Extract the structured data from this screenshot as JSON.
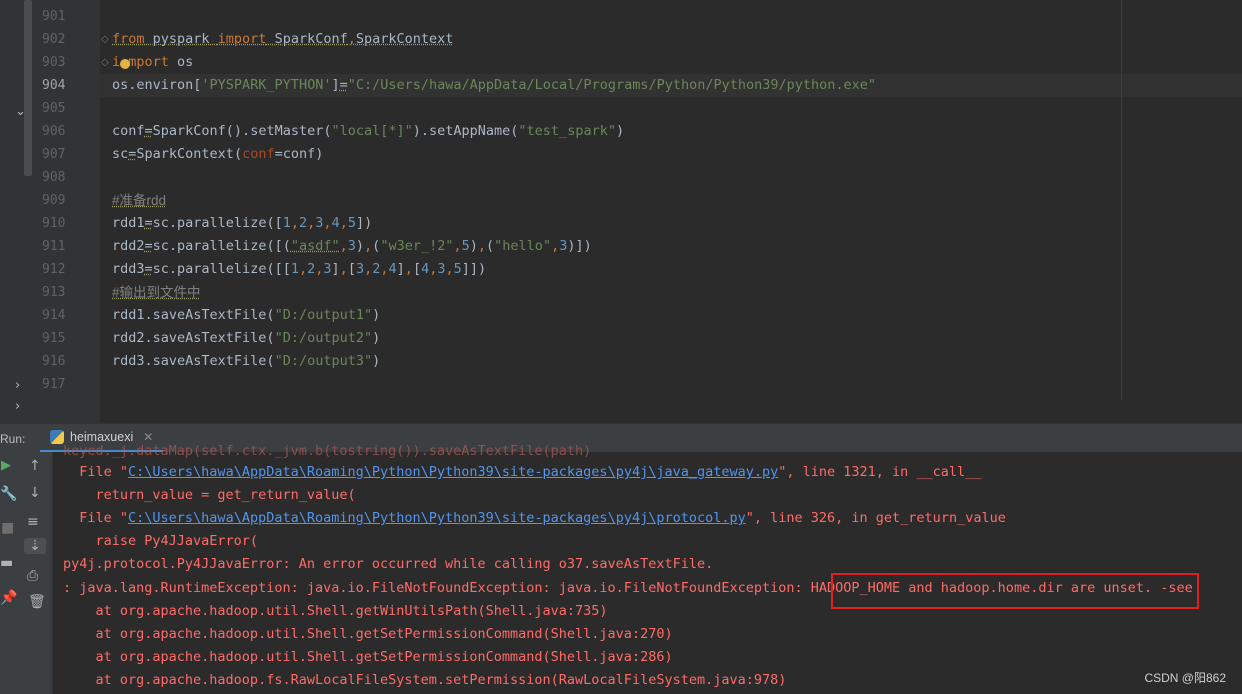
{
  "editor": {
    "line_numbers": [
      "901",
      "902",
      "903",
      "904",
      "905",
      "906",
      "907",
      "908",
      "909",
      "910",
      "911",
      "912",
      "913",
      "914",
      "915",
      "916",
      "917"
    ],
    "active_line": "904",
    "code": {
      "l902": {
        "from": "from",
        "mod": " pyspark ",
        "import": "import",
        "names_a": " SparkConf",
        "comma": ",",
        "names_b": "SparkContext"
      },
      "l903": {
        "i": "i",
        "mport": "mport",
        "rest": " os"
      },
      "l904": {
        "a": "os.environ[",
        "key": "'PYSPARK_PYTHON'",
        "b": "]",
        "eq": "=",
        "val": "\"C:/Users/hawa/AppData/Local/Programs/Python/Python39/python.exe\""
      },
      "l906": {
        "a": "conf",
        "eq": "=",
        "b": "SparkConf().setMaster(",
        "s1": "\"local[*]\"",
        "c": ").setAppName(",
        "s2": "\"test_spark\"",
        "d": ")"
      },
      "l907": {
        "a": "sc",
        "eq": "=",
        "b": "SparkContext(",
        "p": "conf",
        "c": "=conf)"
      },
      "l909": {
        "comment": "#准备rdd"
      },
      "l910": {
        "a": "rdd1",
        "eq": "=",
        "b": "sc.parallelize([",
        "n1": "1",
        "c1": ",",
        "n2": "2",
        "c2": ",",
        "n3": "3",
        "c3": ",",
        "n4": "4",
        "c4": ",",
        "n5": "5",
        "e": "])"
      },
      "l911": {
        "a": "rdd2",
        "eq": "=",
        "b": "sc.parallelize([(",
        "s1": "\"asdf\"",
        "c1": ",",
        "n1": "3",
        "p1": ")",
        "c2": ",",
        "p2": "(",
        "s2": "\"w3er_!2\"",
        "c3": ",",
        "n2": "5",
        "p3": ")",
        "c4": ",",
        "p4": "(",
        "s3": "\"hello\"",
        "c5": ",",
        "n3": "3",
        "e": ")])"
      },
      "l912": {
        "a": "rdd3",
        "eq": "=",
        "b": "sc.parallelize([[",
        "n1": "1",
        "c1": ",",
        "n2": "2",
        "c2": ",",
        "n3": "3",
        "b1": "]",
        "c3": ",",
        "b2": "[",
        "n4": "3",
        "c4": ",",
        "n5": "2",
        "c5": ",",
        "n6": "4",
        "b3": "]",
        "c6": ",",
        "b4": "[",
        "n7": "4",
        "c7": ",",
        "n8": "3",
        "c8": ",",
        "n9": "5",
        "e": "]])"
      },
      "l913": {
        "comment": "#输出到文件中"
      },
      "l914": {
        "a": "rdd1.saveAsTextFile(",
        "s": "\"D:/output1\"",
        "e": ")"
      },
      "l915": {
        "a": "rdd2.saveAsTextFile(",
        "s": "\"D:/output2\"",
        "e": ")"
      },
      "l916": {
        "a": "rdd3.saveAsTextFile(",
        "s": "\"D:/output3\"",
        "e": ")"
      }
    }
  },
  "run_panel": {
    "label": "Run:",
    "tab_name": "heimaxuexi",
    "tab_icon": "python-icon",
    "output": {
      "o0": "keyed._j.dataMap(self.ctx._jvm.b(tostring()).saveAsTextFile(path)",
      "o1_pre": "  File \"",
      "o1_link": "C:\\Users\\hawa\\AppData\\Roaming\\Python\\Python39\\site-packages\\py4j\\java_gateway.py",
      "o1_post": "\", line 1321, in __call__",
      "o2": "    return_value = get_return_value(",
      "o3_pre": "  File \"",
      "o3_link": "C:\\Users\\hawa\\AppData\\Roaming\\Python\\Python39\\site-packages\\py4j\\protocol.py",
      "o3_post": "\", line 326, in get_return_value",
      "o4": "    raise Py4JJavaError(",
      "o5": "py4j.protocol.Py4JJavaError: An error occurred while calling o37.saveAsTextFile.",
      "o6": ": java.lang.RuntimeException: java.io.FileNotFoundException: java.io.FileNotFoundException: HADOOP_HOME and hadoop.home.dir are unset. -see",
      "o7": "    at org.apache.hadoop.util.Shell.getWinUtilsPath(Shell.java:735)",
      "o8": "    at org.apache.hadoop.util.Shell.getSetPermissionCommand(Shell.java:270)",
      "o9": "    at org.apache.hadoop.util.Shell.getSetPermissionCommand(Shell.java:286)",
      "o10": "    at org.apache.hadoop.fs.RawLocalFileSystem.setPermission(RawLocalFileSystem.java:978)"
    }
  },
  "watermark": "CSDN @阳862",
  "colors": {
    "editor_bg": "#2b2b2b",
    "gutter_bg": "#313335",
    "keyword": "#cc7832",
    "string": "#6a8759",
    "number": "#6897bb",
    "error_text": "#ff6b68",
    "link": "#5394ec",
    "highlight_box": "#e02020"
  }
}
